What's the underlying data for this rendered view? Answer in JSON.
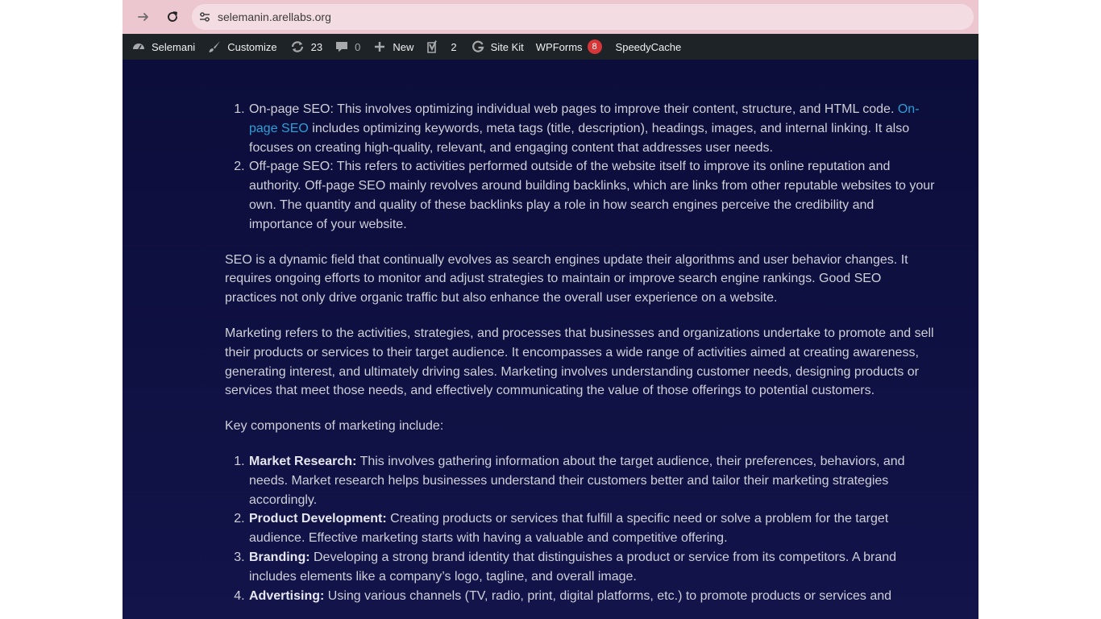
{
  "browser": {
    "url": "selemanin.arellabs.org"
  },
  "admin_bar": {
    "site_name": "Selemani",
    "customize": "Customize",
    "updates": "23",
    "comments": "0",
    "new": "New",
    "yoast_count": "2",
    "site_kit": "Site Kit",
    "wpforms": "WPForms",
    "wpforms_badge": "8",
    "speedycache": "SpeedyCache"
  },
  "article": {
    "seo_list": [
      {
        "lead": "On-page SEO: This involves optimizing individual web pages to improve their content, structure, and HTML code. ",
        "link": "On-page SEO",
        "rest": " includes optimizing keywords, meta tags (title, description), headings, images, and internal linking. It also focuses on creating high-quality, relevant, and engaging content that addresses user needs."
      },
      {
        "text": "Off-page SEO: This refers to activities performed outside of the website itself to improve its online reputation and authority. Off-page SEO mainly revolves around building backlinks, which are links from other reputable websites to your own. The quantity and quality of these backlinks play a role in how search engines perceive the credibility and importance of your website."
      }
    ],
    "p1": "SEO is a dynamic field that continually evolves as search engines update their algorithms and user behavior changes. It requires ongoing efforts to monitor and adjust strategies to maintain or improve search engine rankings. Good SEO practices not only drive organic traffic but also enhance the overall user experience on a website.",
    "p2": "Marketing refers to the activities, strategies, and processes that businesses and organizations undertake to promote and sell their products or services to their target audience. It encompasses a wide range of activities aimed at creating awareness, generating interest, and ultimately driving sales. Marketing involves understanding customer needs, designing products or services that meet those needs, and effectively communicating the value of those offerings to potential customers.",
    "p3": "Key components of marketing include:",
    "marketing_list": [
      {
        "title": "Market Research:",
        "text": " This involves gathering information about the target audience, their preferences, behaviors, and needs. Market research helps businesses understand their customers better and tailor their marketing strategies accordingly."
      },
      {
        "title": "Product Development:",
        "text": " Creating products or services that fulfill a specific need or solve a problem for the target audience. Effective marketing starts with having a valuable and competitive offering."
      },
      {
        "title": "Branding:",
        "text": " Developing a strong brand identity that distinguishes a product or service from its competitors. A brand includes elements like a company’s logo, tagline, and overall image."
      },
      {
        "title": "Advertising:",
        "text": " Using various channels (TV, radio, print, digital platforms, etc.) to promote products or services and"
      }
    ]
  }
}
